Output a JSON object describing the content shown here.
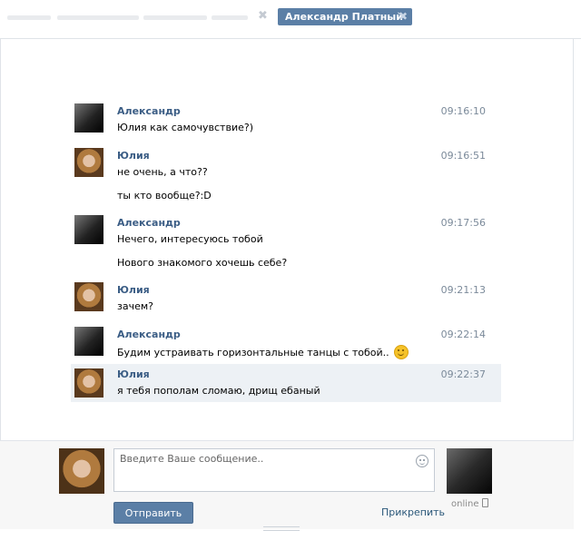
{
  "tabs": {
    "active_label": "Александр Платный"
  },
  "messages": [
    {
      "sender": "Александр",
      "avatar": "alexander",
      "time": "09:16:10",
      "lines": [
        "Юлия как самочувствие?)"
      ]
    },
    {
      "sender": "Юлия",
      "avatar": "yulia",
      "time": "09:16:51",
      "lines": [
        "не очень, а что??",
        "ты кто вообще?:D"
      ]
    },
    {
      "sender": "Александр",
      "avatar": "alexander",
      "time": "09:17:56",
      "lines": [
        "Нечего, интересуюсь тобой",
        "Нового знакомого хочешь себе?"
      ]
    },
    {
      "sender": "Юлия",
      "avatar": "yulia",
      "time": "09:21:13",
      "lines": [
        "зачем?"
      ]
    },
    {
      "sender": "Александр",
      "avatar": "alexander",
      "time": "09:22:14",
      "lines": [
        "Будим устраивать горизонтальные танцы с тобой.."
      ],
      "emoji": "smile-icon"
    },
    {
      "sender": "Юлия",
      "avatar": "yulia",
      "time": "09:22:37",
      "lines": [
        "я тебя пополам сломаю, дрищ ебаный"
      ],
      "highlighted": true
    }
  ],
  "composer": {
    "placeholder": "Введите Ваше сообщение..",
    "send_label": "Отправить",
    "attach_label": "Прикрепить",
    "peer_status": "online"
  },
  "colors": {
    "accent": "#5b7fa6",
    "sender": "#3b5d85",
    "link": "#2b587a",
    "highlight": "#edf1f5"
  }
}
